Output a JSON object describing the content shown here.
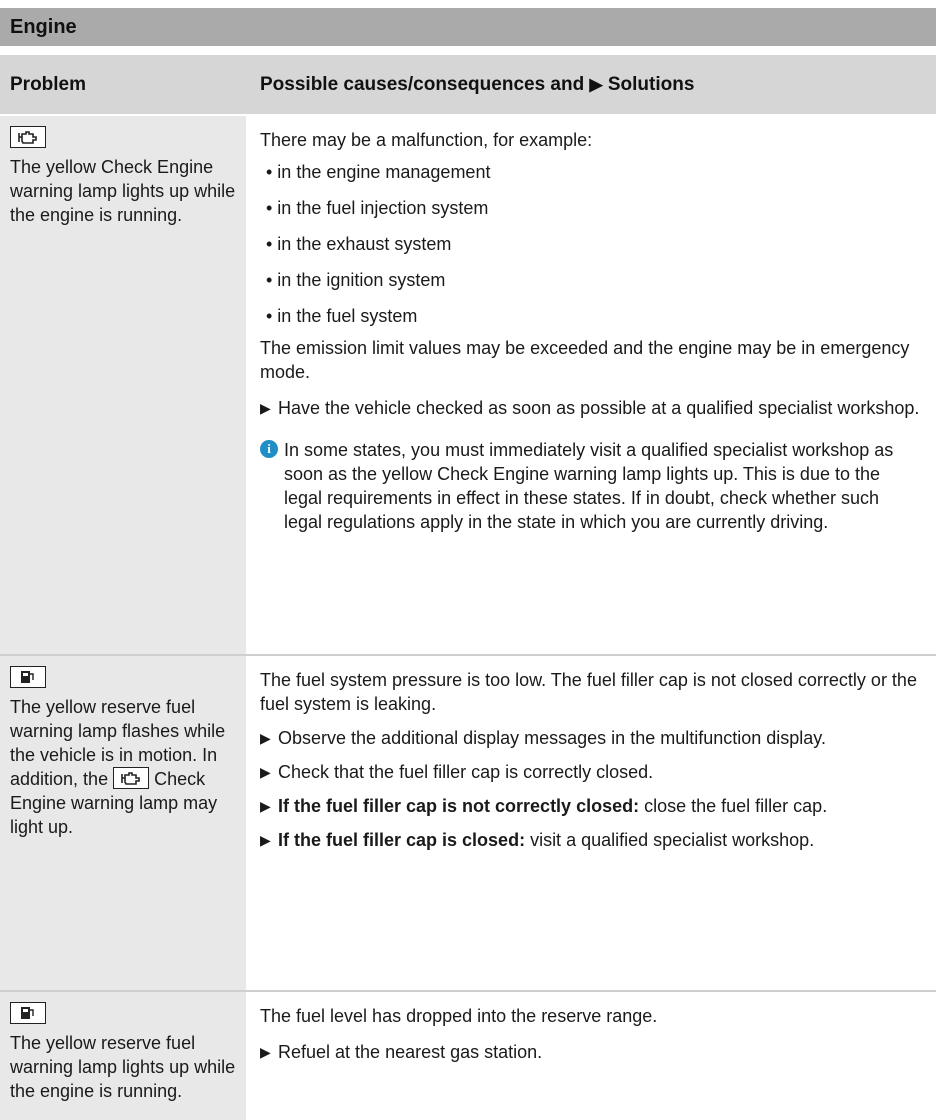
{
  "section": {
    "title": "Engine"
  },
  "table": {
    "header": {
      "problem": "Problem",
      "causes_prefix": "Possible causes/consequences and",
      "causes_suffix": "Solutions"
    },
    "rows": [
      {
        "icon": "check-engine-icon",
        "problem": "The yellow Check Engine warning lamp lights up while the engine is running.",
        "intro": "There may be a malfunction, for example:",
        "bullets": [
          "• in the engine management",
          "• in the fuel injection system",
          "• in the exhaust system",
          "• in the ignition system",
          "• in the fuel system"
        ],
        "consequence": "The emission limit values may be exceeded and the engine may be in emergency mode.",
        "step": "Have the vehicle checked as soon as possible at a qualified specialist workshop.",
        "info": "In some states, you must immediately visit a qualified specialist workshop as soon as the yellow Check Engine warning lamp lights up. This is due to the legal requirements in effect in these states. If in doubt, check whether such legal regulations apply in the state in which you are currently driving."
      },
      {
        "icon": "reserve-fuel-icon",
        "problem_part1": "The yellow reserve fuel warning lamp flashes while the vehicle is in motion. In addition, the",
        "problem_part2": "Check Engine warning lamp may light up.",
        "intro": "The fuel system pressure is too low. The fuel filler cap is not closed correctly or the fuel system is leaking.",
        "steps": [
          {
            "bold": "",
            "text": "Observe the additional display messages in the multifunction display."
          },
          {
            "bold": "",
            "text": "Check that the fuel filler cap is correctly closed."
          },
          {
            "bold": "If the fuel filler cap is not correctly closed:",
            "text": " close the fuel filler cap."
          },
          {
            "bold": "If the fuel filler cap is closed:",
            "text": " visit a qualified specialist workshop."
          }
        ]
      },
      {
        "icon": "reserve-fuel-icon",
        "problem": "The yellow reserve fuel warning lamp lights up while the engine is running.",
        "intro": "The fuel level has dropped into the reserve range.",
        "step": "Refuel at the nearest gas station."
      }
    ]
  }
}
